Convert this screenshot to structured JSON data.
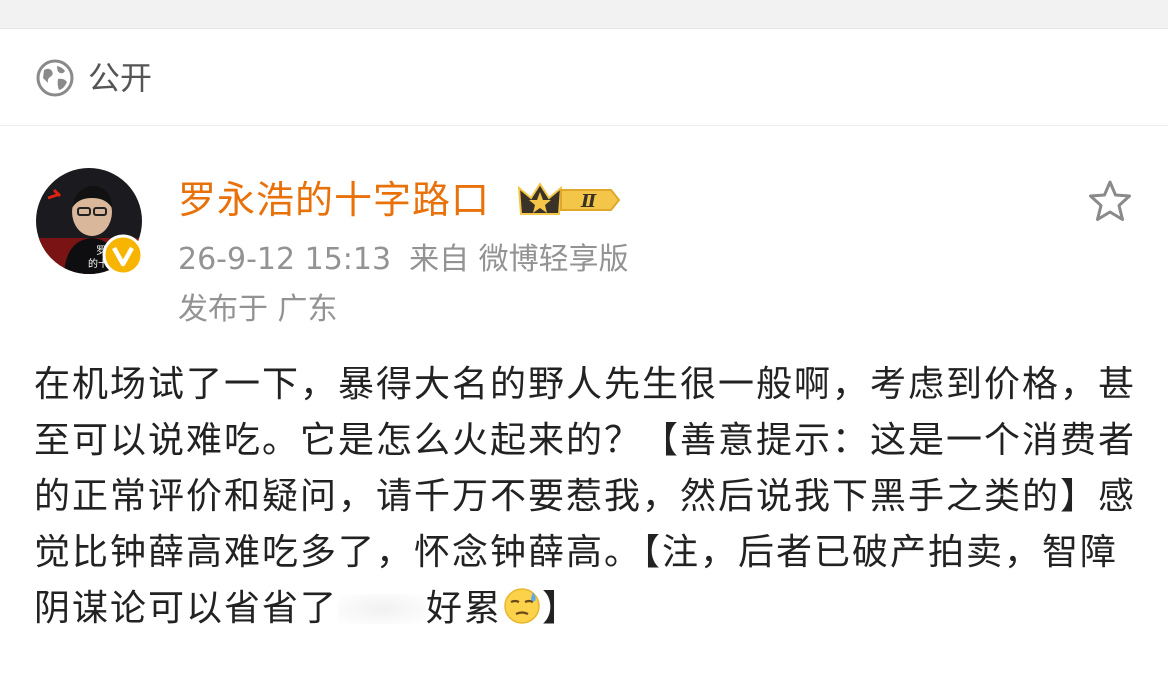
{
  "visibility": {
    "icon": "globe-icon",
    "label": "公开"
  },
  "author": {
    "name": "罗永浩的十字路口",
    "avatar_caption_line1": "罗永浩",
    "avatar_caption_line2": "的十字路口",
    "vip_level": "Ⅱ",
    "name_color": "#e8710a",
    "verified": true
  },
  "meta": {
    "timestamp": "26-9-12 15:13",
    "source": "来自 微博轻享版",
    "location": "发布于 广东"
  },
  "post": {
    "text_part1": "在机场试了一下，暴得大名的野人先生很一般啊，考虑到价格，甚至可以说难吃。它是怎么火起来的？【善意提示：这是一个消费者的正常评价和疑问，请千万不要惹我，然后说我下黑手之类的】感觉比钟薛高难吃多了，怀念钟薛高。【注，后者已破产拍卖，智障阴谋论可以省省了",
    "text_part2": "好累",
    "text_part3": "】",
    "emoji": "sweat-emoji"
  },
  "actions": {
    "favorite_icon": "star-icon"
  }
}
